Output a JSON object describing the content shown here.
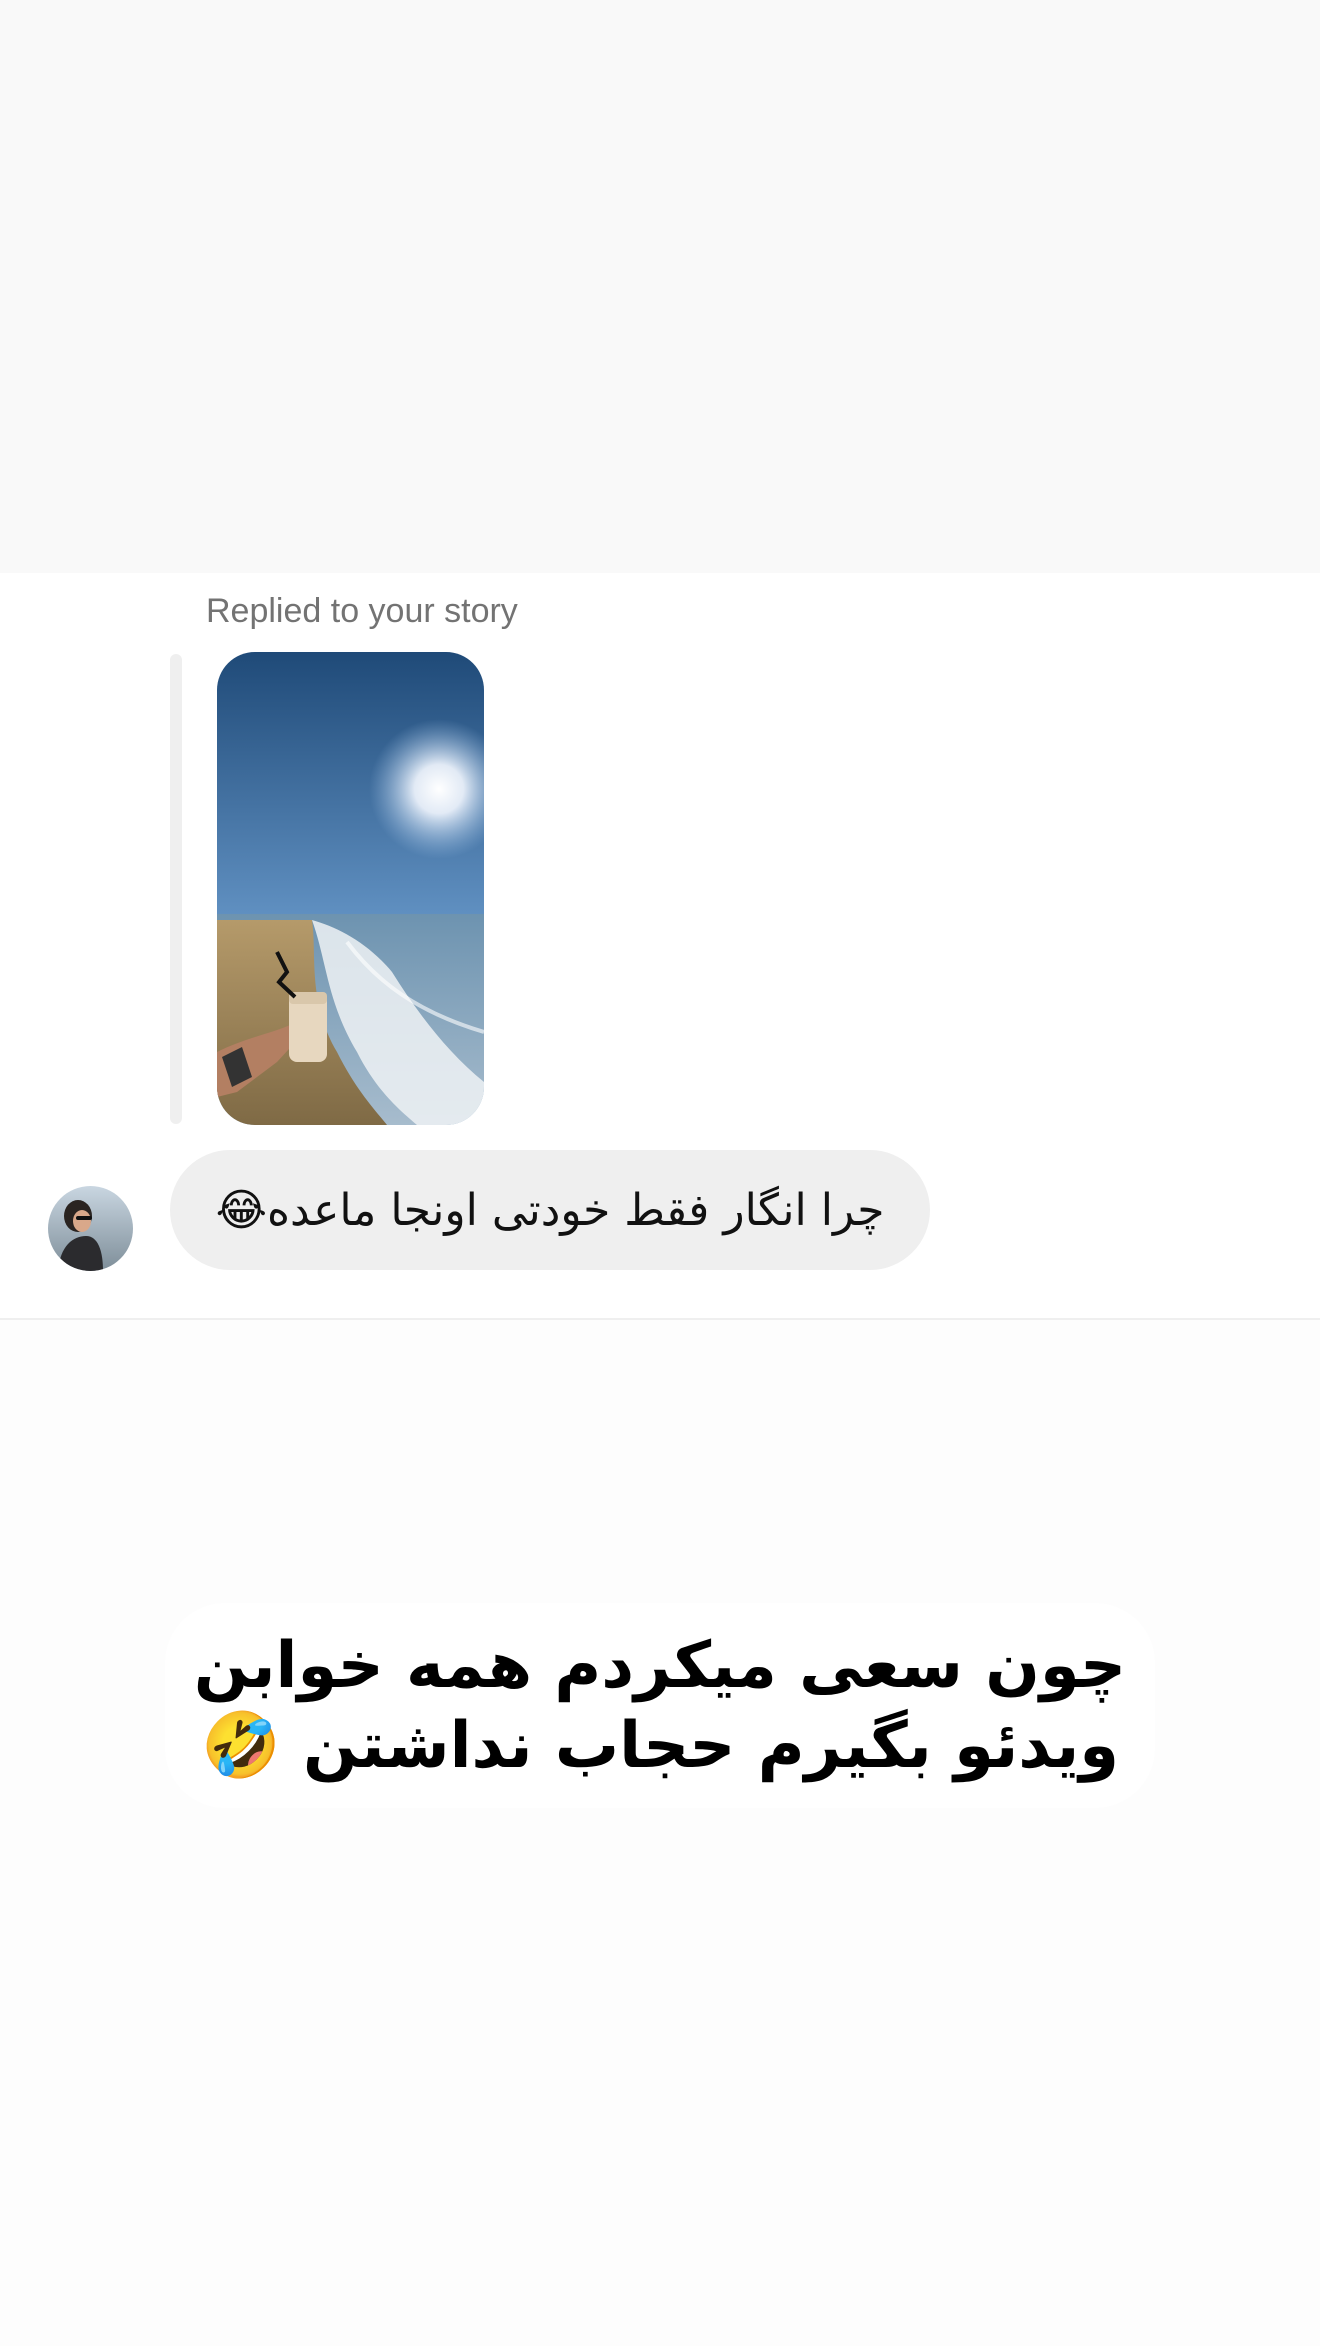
{
  "chat": {
    "reply_label": "Replied to your story",
    "message_text": "چرا انگار فقط خودتی اونجا ماعده😂",
    "story_thumbnail_icon": "beach-story-image",
    "avatar_icon": "user-avatar-image"
  },
  "caption": {
    "line1": "چون سعی میکردم همه خوابن",
    "line2": "ویدئو بگیرم حجاب نداشتن 🤣"
  }
}
